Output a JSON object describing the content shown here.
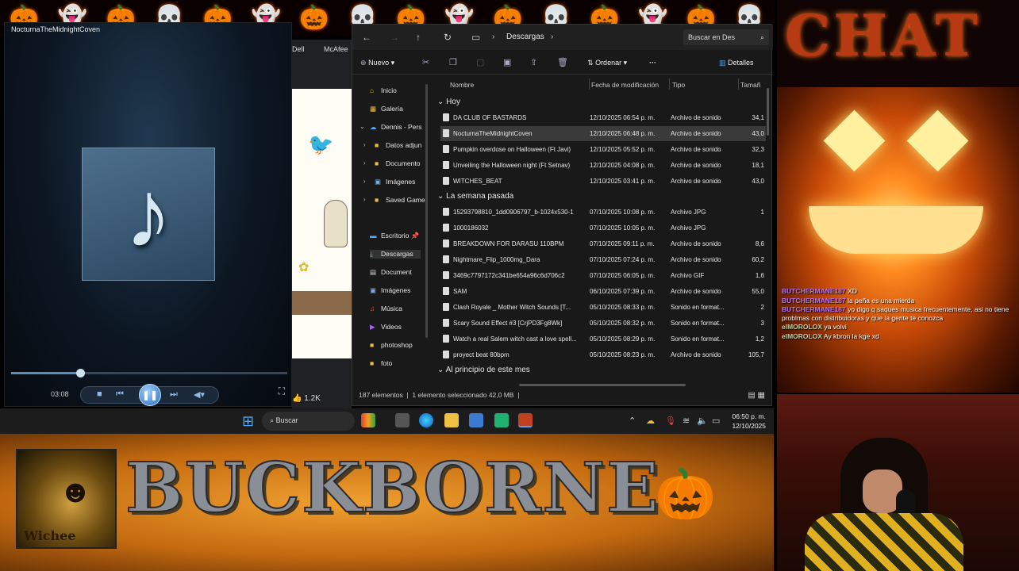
{
  "colors": {
    "accent": "#4aa8ff",
    "chat_user": "#b070ff",
    "banner_bg": "#0a0000"
  },
  "banner_icons": [
    "pumpkin-icon",
    "ghost-icon",
    "pumpkin-icon",
    "skull-icon",
    "pumpkin-icon",
    "ghost-icon",
    "pumpkin-icon",
    "skull-icon",
    "pumpkin-icon",
    "ghost-icon",
    "pumpkin-icon",
    "skull-icon",
    "pumpkin-icon",
    "ghost-icon",
    "pumpkin-icon",
    "skull-icon"
  ],
  "player": {
    "title": "NocturnaTheMidnightCoven",
    "time": "03:08",
    "progress": 0.25
  },
  "browser": {
    "bookmarks": [
      "Dell",
      "McAfee"
    ],
    "likes": "1.2K"
  },
  "explorer": {
    "path": "Descargas",
    "search_placeholder": "Buscar en Des",
    "toolbar": {
      "new_label": "Nuevo",
      "sort_label": "Ordenar",
      "more_label": "···",
      "details_label": "Detalles"
    },
    "nav": [
      {
        "label": "Inicio",
        "icon": "home-icon"
      },
      {
        "label": "Galería",
        "icon": "gallery-icon"
      },
      {
        "label": "Dennis - Pers",
        "icon": "cloud-icon"
      },
      {
        "label": "Datos adjun",
        "icon": "folder-icon"
      },
      {
        "label": "Documento",
        "icon": "folder-icon"
      },
      {
        "label": "Imágenes",
        "icon": "image-icon"
      },
      {
        "label": "Saved Game",
        "icon": "folder-icon"
      },
      {
        "label": "Escritorio",
        "icon": "desktop-icon"
      },
      {
        "label": "Descargas",
        "icon": "download-icon"
      },
      {
        "label": "Document",
        "icon": "document-icon"
      },
      {
        "label": "Imágenes",
        "icon": "image-icon"
      },
      {
        "label": "Música",
        "icon": "music-icon"
      },
      {
        "label": "Videos",
        "icon": "video-icon"
      },
      {
        "label": "photoshop",
        "icon": "folder-icon"
      },
      {
        "label": "foto",
        "icon": "folder-icon"
      }
    ],
    "columns": {
      "name": "Nombre",
      "date": "Fecha de modificación",
      "type": "Tipo",
      "size": "Tamañ"
    },
    "groups": [
      "Hoy",
      "La semana pasada",
      "Al principio de este mes"
    ],
    "files_today": [
      {
        "name": "DA CLUB OF BASTARDS",
        "date": "12/10/2025 06:54 p. m.",
        "type": "Archivo de sonido",
        "size": "34,1"
      },
      {
        "name": "NocturnaTheMidnightCoven",
        "date": "12/10/2025 06:48 p. m.",
        "type": "Archivo de sonido",
        "size": "43,0"
      },
      {
        "name": "Pumpkin overdose on Halloween (Ft Javi)",
        "date": "12/10/2025 05:52 p. m.",
        "type": "Archivo de sonido",
        "size": "32,3"
      },
      {
        "name": "Unveiling the Halloween night (Ft Setnav)",
        "date": "12/10/2025 04:08 p. m.",
        "type": "Archivo de sonido",
        "size": "18,1"
      },
      {
        "name": "WITCHES_BEAT",
        "date": "12/10/2025 03:41 p. m.",
        "type": "Archivo de sonido",
        "size": "43,0"
      }
    ],
    "files_week": [
      {
        "name": "15293798810_1dd0906797_b-1024x530-1",
        "date": "07/10/2025 10:08 p. m.",
        "type": "Archivo JPG",
        "size": "1"
      },
      {
        "name": "1000186032",
        "date": "07/10/2025 10:05 p. m.",
        "type": "Archivo JPG",
        "size": ""
      },
      {
        "name": "BREAKDOWN FOR DARASU 110BPM",
        "date": "07/10/2025 09:11 p. m.",
        "type": "Archivo de sonido",
        "size": "8,6"
      },
      {
        "name": "Nightmare_Flip_1000mg_Dara",
        "date": "07/10/2025 07:24 p. m.",
        "type": "Archivo de sonido",
        "size": "60,2"
      },
      {
        "name": "3469c7797172c341be654a96c6d706c2",
        "date": "07/10/2025 06:05 p. m.",
        "type": "Archivo GIF",
        "size": "1,6"
      },
      {
        "name": "SAM",
        "date": "06/10/2025 07:39 p. m.",
        "type": "Archivo de sonido",
        "size": "55,0"
      },
      {
        "name": "Clash Royale _ Mother Witch Sounds [T...",
        "date": "05/10/2025 08:33 p. m.",
        "type": "Sonido en format...",
        "size": "2"
      },
      {
        "name": "Scary Sound Effect #3 [CrjPD3Fg8Wk]",
        "date": "05/10/2025 08:32 p. m.",
        "type": "Sonido en format...",
        "size": "3"
      },
      {
        "name": "Watch a real Salem witch cast a love spell...",
        "date": "05/10/2025 08:29 p. m.",
        "type": "Sonido en format...",
        "size": "1,2"
      },
      {
        "name": "proyect beat 80bpm",
        "date": "05/10/2025 08:23 p. m.",
        "type": "Archivo de sonido",
        "size": "105,7"
      }
    ],
    "status_count": "187 elementos",
    "status_selected": "1 elemento seleccionado  42,0 MB"
  },
  "taskbar": {
    "search_label": "Buscar",
    "time": "06:50 p. m.",
    "date": "12/10/2025"
  },
  "bottom_banner": {
    "logo_text": "Wichee",
    "title": "BUCKBORNE"
  },
  "chat_panel": {
    "header": "CHAT",
    "messages": [
      {
        "user": "BUTCHERMANE187",
        "text": "XD"
      },
      {
        "user": "BUTCHERMANE187",
        "text": "la peña es una mierda"
      },
      {
        "user": "BUTCHERMANE187",
        "text": "yo digo q saques musica frecuentemente, asi no tiene problmas con distribuidoras y que la gente te conozca"
      },
      {
        "user": "elMOROLOX",
        "text": "ya volvi"
      },
      {
        "user": "elMOROLOX",
        "text": "Ay kbron la kge xd"
      }
    ]
  }
}
